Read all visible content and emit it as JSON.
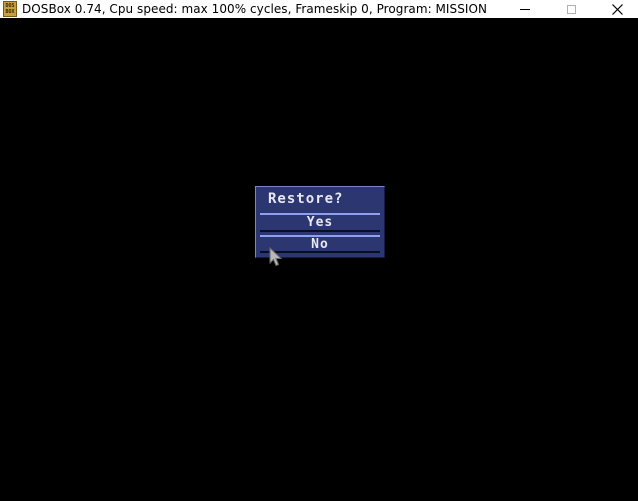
{
  "window": {
    "title": "DOSBox 0.74, Cpu speed: max 100% cycles, Frameskip  0, Program:  MISSION",
    "icon": "dosbox-icon",
    "icon_text_top": "DOS",
    "icon_text_bottom": "BOX"
  },
  "dialog": {
    "title": "Restore?",
    "options": [
      {
        "label": "Yes"
      },
      {
        "label": "No"
      }
    ],
    "colors": {
      "background": "#2c3670",
      "divider_light": "#8ea0f0",
      "divider_dark": "#0a0e24",
      "text": "#e8e8f4"
    }
  },
  "cursor": {
    "icon": "mouse-pointer-icon"
  }
}
